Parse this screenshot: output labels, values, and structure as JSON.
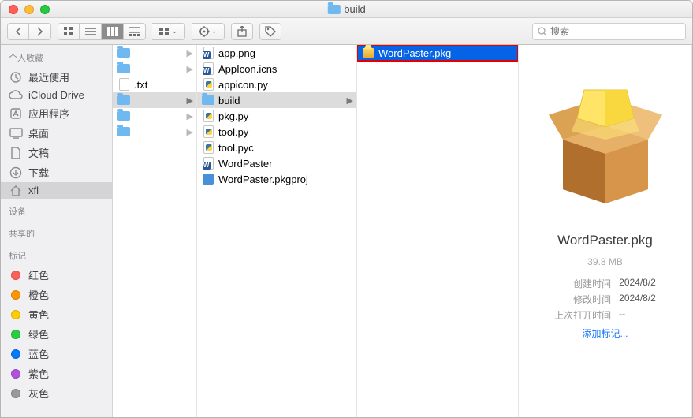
{
  "window": {
    "title": "build"
  },
  "toolbar": {
    "search_placeholder": "搜索"
  },
  "sidebar": {
    "sections": [
      {
        "header": "个人收藏",
        "items": [
          {
            "icon": "clock",
            "label": "最近使用"
          },
          {
            "icon": "cloud",
            "label": "iCloud Drive"
          },
          {
            "icon": "app",
            "label": "应用程序"
          },
          {
            "icon": "desktop",
            "label": "桌面"
          },
          {
            "icon": "doc",
            "label": "文稿"
          },
          {
            "icon": "download",
            "label": "下载"
          },
          {
            "icon": "home",
            "label": "xfl",
            "selected": true
          }
        ]
      },
      {
        "header": "设备",
        "items": []
      },
      {
        "header": "共享的",
        "items": []
      },
      {
        "header": "标记",
        "items": [
          {
            "tag": "#ff5f56",
            "label": "红色"
          },
          {
            "tag": "#ff9500",
            "label": "橙色"
          },
          {
            "tag": "#ffcc00",
            "label": "黄色"
          },
          {
            "tag": "#28cd41",
            "label": "绿色"
          },
          {
            "tag": "#007aff",
            "label": "蓝色"
          },
          {
            "tag": "#af52de",
            "label": "紫色"
          },
          {
            "tag": "#999999",
            "label": "灰色"
          }
        ]
      }
    ]
  },
  "col1": [
    {
      "label": "",
      "type": "folder",
      "has_children": true
    },
    {
      "label": "",
      "type": "folder",
      "has_children": true
    },
    {
      "label": ".txt",
      "type": "doc"
    },
    {
      "label": "",
      "type": "folder",
      "has_children": true,
      "selected": true
    },
    {
      "label": "",
      "type": "folder",
      "has_children": true
    },
    {
      "label": "",
      "type": "folder",
      "has_children": true
    }
  ],
  "col2": [
    {
      "label": "app.png",
      "type": "word"
    },
    {
      "label": "AppIcon.icns",
      "type": "word"
    },
    {
      "label": "appicon.py",
      "type": "py"
    },
    {
      "label": "build",
      "type": "folder",
      "has_children": true,
      "selected": true
    },
    {
      "label": "pkg.py",
      "type": "py"
    },
    {
      "label": "tool.py",
      "type": "py"
    },
    {
      "label": "tool.pyc",
      "type": "py"
    },
    {
      "label": "WordPaster",
      "type": "word"
    },
    {
      "label": "WordPaster.pkgproj",
      "type": "proj"
    }
  ],
  "col3": [
    {
      "label": "WordPaster.pkg",
      "type": "pkg",
      "selected_blue": true,
      "highlight": true
    }
  ],
  "preview": {
    "name": "WordPaster.pkg",
    "size": "39.8 MB",
    "meta": [
      {
        "label": "创建时间",
        "value": "2024/8/2"
      },
      {
        "label": "修改时间",
        "value": "2024/8/2"
      },
      {
        "label": "上次打开时间",
        "value": "--"
      }
    ],
    "add_tag": "添加标记..."
  }
}
